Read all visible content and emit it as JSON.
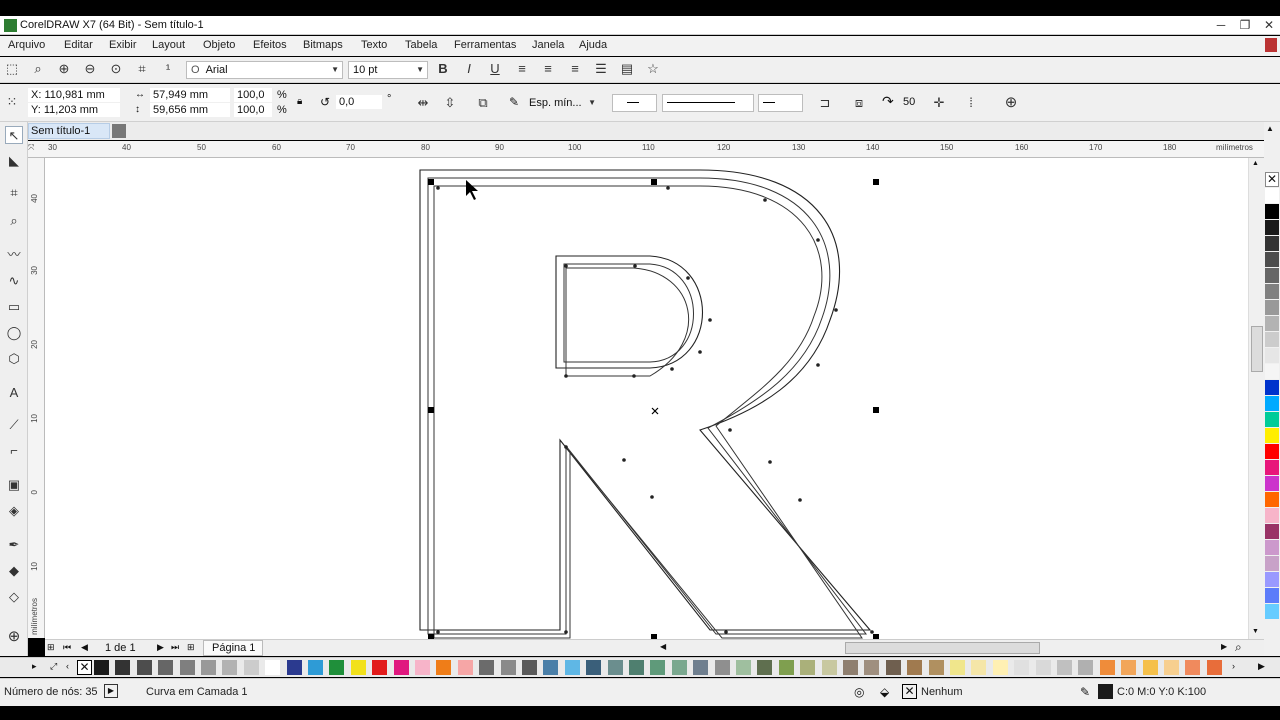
{
  "window": {
    "title": "CorelDRAW X7 (64 Bit) - Sem título-1"
  },
  "menu": [
    "Arquivo",
    "Editar",
    "Exibir",
    "Layout",
    "Objeto",
    "Efeitos",
    "Bitmaps",
    "Texto",
    "Tabela",
    "Ferramentas",
    "Janela",
    "Ajuda"
  ],
  "text_toolbar": {
    "font": "Arial",
    "size": "10 pt"
  },
  "property_bar": {
    "x": "X: 110,981 mm",
    "y": "Y: 11,203 mm",
    "width": "57,949 mm",
    "height": "59,656 mm",
    "scale_x": "100,0",
    "scale_y": "100,0",
    "percent": "%",
    "rotation": "0,0",
    "degree": "°",
    "outline_width": "Esp. mín...",
    "smoothing": "50"
  },
  "document_tab": "Sem título-1",
  "ruler": {
    "h_ticks": [
      "30",
      "40",
      "50",
      "60",
      "70",
      "80",
      "90",
      "100",
      "110",
      "120",
      "130",
      "140",
      "150",
      "160",
      "170",
      "180"
    ],
    "unit": "milímetros",
    "v_ticks": [
      "40",
      "30",
      "20",
      "10",
      "0",
      "10"
    ],
    "v_unit": "milímetros"
  },
  "page_nav": {
    "count": "1 de 1",
    "page": "Página 1"
  },
  "status": {
    "nodes": "Número de nós: 35",
    "object": "Curva em Camada 1",
    "fill": "Nenhum",
    "outline_color": "C:0 M:0 Y:0 K:100"
  },
  "palette_colors": [
    "#ffffff",
    "#000000",
    "#1a1a1a",
    "#333333",
    "#4d4d4d",
    "#666666",
    "#808080",
    "#999999",
    "#b3b3b3",
    "#cccccc",
    "#e6e6e6",
    "#f5f5f5",
    "#0033cc",
    "#00aaff",
    "#00cc99",
    "#ffee00",
    "#ff0000",
    "#e8167b",
    "#cc33cc",
    "#ff6600",
    "#f7b4c9",
    "#993366",
    "#cc99cc",
    "#c8a2c8",
    "#9999ff",
    "#5c7cfa",
    "#66ccff"
  ],
  "hpalette_colors": [
    "#1a1a1a",
    "#333333",
    "#4d4d4d",
    "#666666",
    "#7f7f7f",
    "#999999",
    "#b2b2b2",
    "#cccccc",
    "#ffffff",
    "#2b3a8f",
    "#2e9bd6",
    "#1f8f3a",
    "#f2e11b",
    "#e21b1b",
    "#e0187f",
    "#f7b4c9",
    "#ef7d18",
    "#f6a6a6",
    "#6b6b6b",
    "#8a8a8a",
    "#5a5a5a",
    "#4a7fa8",
    "#5fb7e5",
    "#3a5f7a",
    "#6b8e8e",
    "#4f7f6f",
    "#5f9a7a",
    "#7aa88f",
    "#6f7f8f",
    "#8f8f8f",
    "#9fbf9f",
    "#5f6f4f",
    "#7f9f4f",
    "#aab07a",
    "#c8c8a0",
    "#8f7f6f",
    "#9f8f7f",
    "#6f5f4f",
    "#a07a4f",
    "#b09060",
    "#f0e68c",
    "#f5e6a8",
    "#fff0b3",
    "#e0e0e0",
    "#d9d9d9",
    "#c0c0c0",
    "#b0b0b0",
    "#ef8c3a",
    "#f2a65a",
    "#f5c04a",
    "#f7cf8f",
    "#f08a5d",
    "#e86d3a"
  ]
}
